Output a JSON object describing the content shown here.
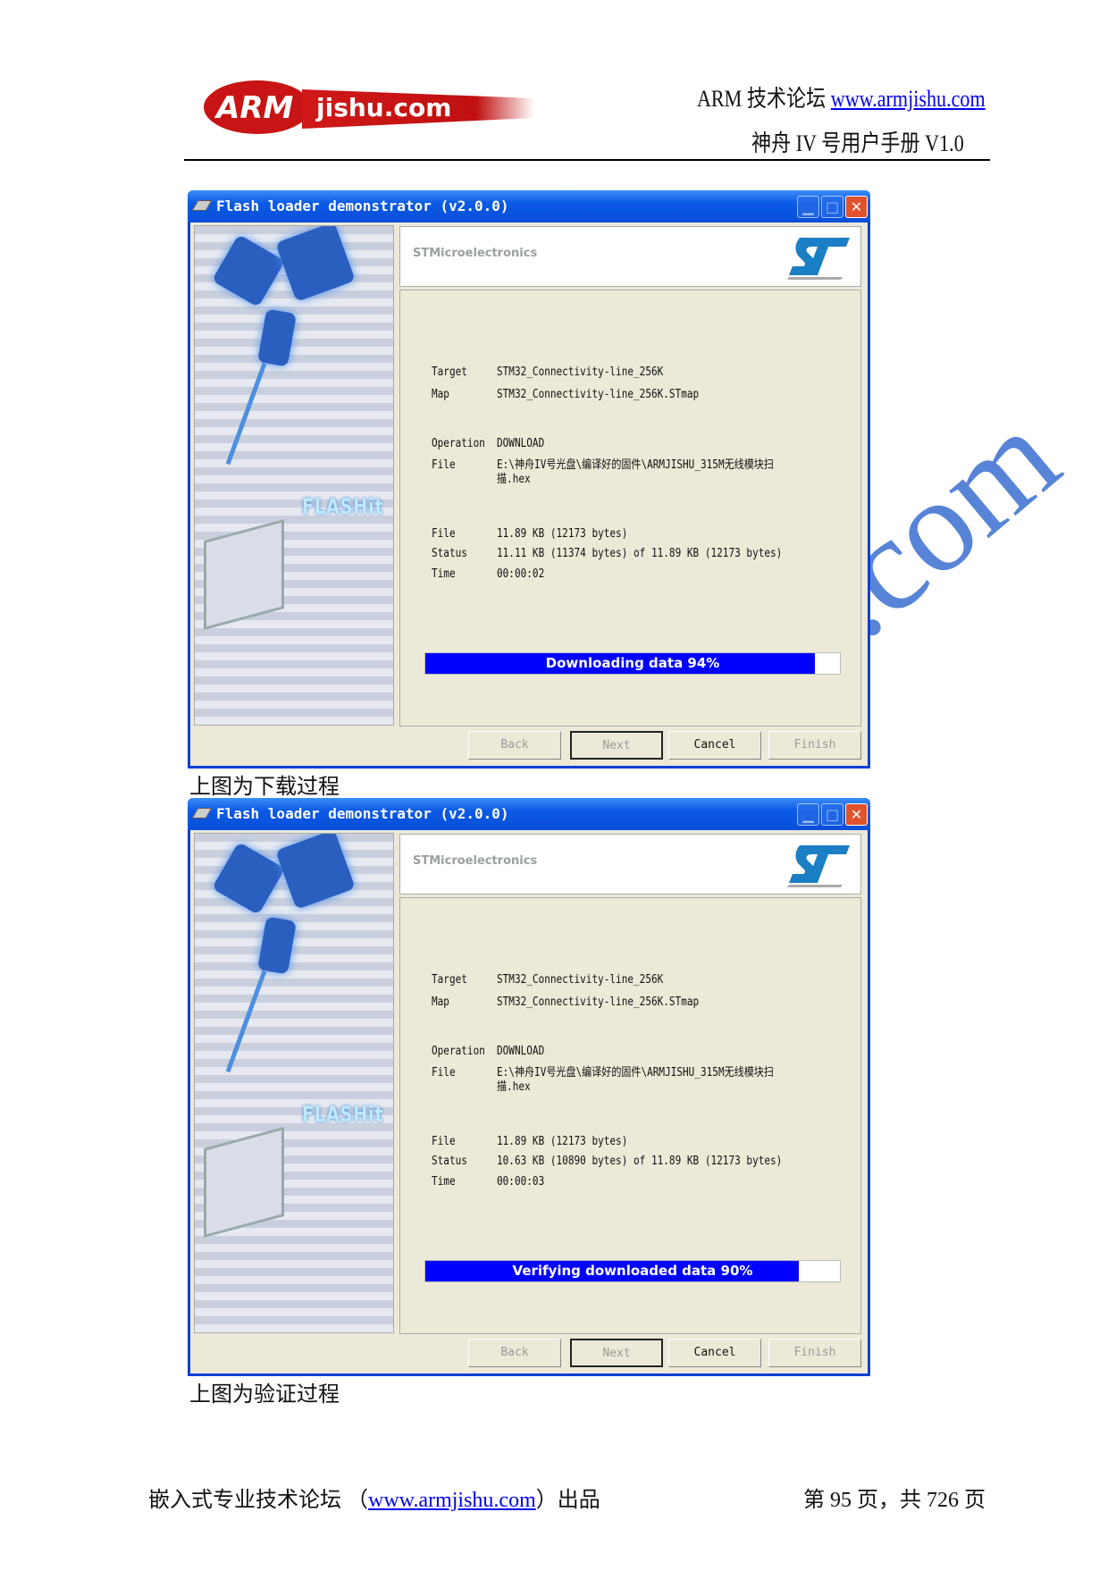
{
  "header": {
    "logo_text": "ARMjishu.com",
    "site_prefix": "ARM 技术论坛 ",
    "site_link": "www.armjishu.com",
    "manual_title": "神舟 IV 号用户手册 V1.0"
  },
  "watermark": ".com",
  "windows": [
    {
      "title": "Flash loader demonstrator (v2.0.0)",
      "side_text": "FLASHit",
      "vendor": "STMicroelectronics",
      "rows": [
        {
          "label": "Target",
          "value": "STM32_Connectivity-line_256K"
        },
        {
          "label": "Map",
          "value": "STM32_Connectivity-line_256K.STmap"
        },
        {
          "label": "Operation",
          "value": "DOWNLOAD"
        },
        {
          "label": "File",
          "value": "E:\\神舟IV号光盘\\编译好的固件\\ARMJISHU_315M无线模块扫描.hex"
        },
        {
          "label": "File",
          "value": "11.89 KB (12173 bytes)"
        },
        {
          "label": "Status",
          "value": "11.11 KB (11374 bytes) of 11.89 KB (12173 bytes)"
        },
        {
          "label": "Time",
          "value": "00:00:02"
        }
      ],
      "progress_label": "Downloading data 94%",
      "progress_percent": 94,
      "buttons": {
        "back": "Back",
        "next": "Next",
        "cancel": "Cancel",
        "finish": "Finish"
      }
    },
    {
      "title": "Flash loader demonstrator (v2.0.0)",
      "side_text": "FLASHit",
      "vendor": "STMicroelectronics",
      "rows": [
        {
          "label": "Target",
          "value": "STM32_Connectivity-line_256K"
        },
        {
          "label": "Map",
          "value": "STM32_Connectivity-line_256K.STmap"
        },
        {
          "label": "Operation",
          "value": "DOWNLOAD"
        },
        {
          "label": "File",
          "value": "E:\\神舟IV号光盘\\编译好的固件\\ARMJISHU_315M无线模块扫描.hex"
        },
        {
          "label": "File",
          "value": "11.89 KB (12173 bytes)"
        },
        {
          "label": "Status",
          "value": "10.63 KB (10890 bytes) of 11.89 KB (12173 bytes)"
        },
        {
          "label": "Time",
          "value": "00:00:03"
        }
      ],
      "progress_label": "Verifying downloaded data 90%",
      "progress_percent": 90,
      "buttons": {
        "back": "Back",
        "next": "Next",
        "cancel": "Cancel",
        "finish": "Finish"
      }
    }
  ],
  "captions": [
    "上图为下载过程",
    "上图为验证过程"
  ],
  "footer": {
    "left_prefix": "嵌入式专业技术论坛 （",
    "left_link": "www.armjishu.com",
    "left_suffix": "）出品",
    "page_info": "第 95 页，共 726 页"
  },
  "colors": {
    "title_bar": "#0a4fd8",
    "progress_fill": "#0000ff",
    "link": "#0000ee",
    "logo_red": "#cc1a1a",
    "st_blue": "#1a7fc4"
  }
}
